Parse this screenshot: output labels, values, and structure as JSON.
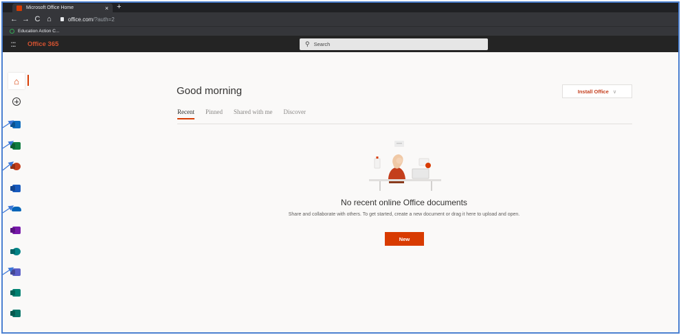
{
  "browser": {
    "tab_title": "Microsoft Office Home",
    "tab_close": "×",
    "new_tab": "+",
    "nav": {
      "back": "←",
      "forward": "→",
      "reload": "C",
      "home": "⌂"
    },
    "url_host": "office.com",
    "url_path": "/?auth=2",
    "bookmark": "Education Action C..."
  },
  "header": {
    "app_launcher": ":::",
    "brand": "Office 365",
    "search_placeholder": "Search",
    "brand_color": "#d35230"
  },
  "rail": {
    "items": [
      {
        "name": "Home",
        "icon": "home-icon",
        "color": "#d83b01",
        "active": true
      },
      {
        "name": "Create",
        "icon": "create-icon"
      },
      {
        "name": "Outlook",
        "icon": "outlook-icon",
        "color": "#0f6cbd"
      },
      {
        "name": "Excel",
        "icon": "excel-icon",
        "color": "#107c41"
      },
      {
        "name": "PowerPoint",
        "icon": "powerpoint-icon",
        "color": "#c43e1c"
      },
      {
        "name": "Word",
        "icon": "word-icon",
        "color": "#185abd"
      },
      {
        "name": "OneDrive",
        "icon": "onedrive-icon",
        "color": "#0364b8"
      },
      {
        "name": "OneNote",
        "icon": "onenote-icon",
        "color": "#7719aa"
      },
      {
        "name": "SharePoint",
        "icon": "sharepoint-icon",
        "color": "#038387"
      },
      {
        "name": "Teams",
        "icon": "teams-icon",
        "color": "#5b5fc7"
      },
      {
        "name": "Sway",
        "icon": "sway-icon",
        "color": "#008272"
      },
      {
        "name": "Forms",
        "icon": "forms-icon",
        "color": "#077568"
      }
    ]
  },
  "main": {
    "greeting": "Good morning",
    "install_label": "Install Office",
    "install_chevron": "∨",
    "tabs": [
      {
        "label": "Recent",
        "selected": true
      },
      {
        "label": "Pinned"
      },
      {
        "label": "Shared with me"
      },
      {
        "label": "Discover"
      }
    ],
    "empty_title": "No recent online Office documents",
    "empty_desc": "Share and collaborate with others. To get started, create a new document or drag it here to upload and open.",
    "new_label": "New",
    "accent_color": "#d83b01"
  }
}
